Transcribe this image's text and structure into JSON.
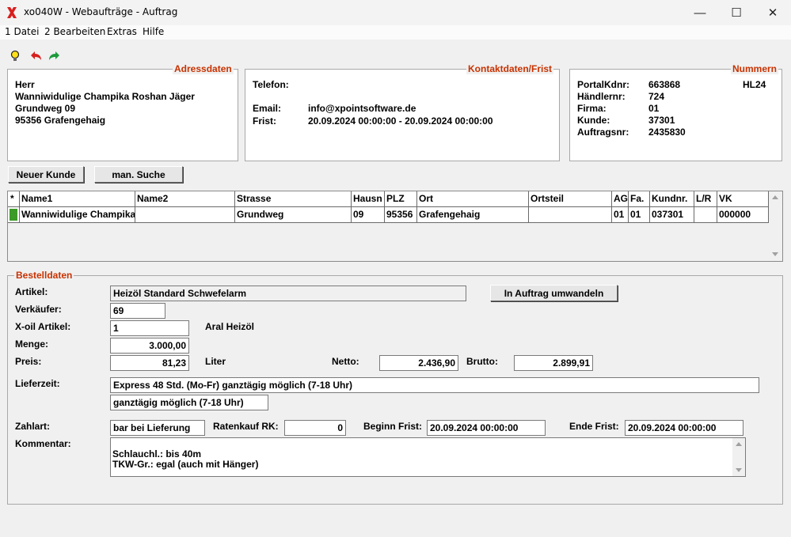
{
  "window": {
    "title": "xo040W - Webaufträge - Auftrag",
    "app_icon": "red-x-icon",
    "minimize": "—",
    "maximize": "☐",
    "close": "✕"
  },
  "menu": [
    "1 Datei",
    "2 Bearbeiten",
    "Extras",
    "Hilfe"
  ],
  "toolbar": {
    "icons": [
      "lightbulb-icon",
      "undo-icon",
      "redo-icon"
    ]
  },
  "adressdaten": {
    "title": "Adressdaten",
    "lines": [
      "Herr",
      "Wanniwidulige Champika Roshan  Jäger",
      "Grundweg 09",
      "95356 Grafengehaig"
    ]
  },
  "kontakt": {
    "title": "Kontaktdaten/Frist",
    "telefon_label": "Telefon:",
    "telefon_value": "",
    "email_label": "Email:",
    "email_value": "info@xpointsoftware.de",
    "frist_label": "Frist:",
    "frist_value": "20.09.2024 00:00:00  - 20.09.2024 00:00:00"
  },
  "nummern": {
    "title": "Nummern",
    "extra": "HL24",
    "rows": [
      {
        "label": "PortalKdnr:",
        "value": "663868"
      },
      {
        "label": "Händlernr:",
        "value": "724"
      },
      {
        "label": "Firma:",
        "value": "01"
      },
      {
        "label": "Kunde:",
        "value": "37301"
      },
      {
        "label": "Auftragsnr:",
        "value": "2435830"
      }
    ]
  },
  "buttons": {
    "neuer_kunde": "Neuer Kunde",
    "man_suche": "man. Suche",
    "umwandeln": "In Auftrag umwandeln"
  },
  "grid": {
    "columns": [
      "*",
      "Name1",
      "Name2",
      "Strasse",
      "Hausn",
      "PLZ",
      "Ort",
      "Ortsteil",
      "AG",
      "Fa.",
      "Kundnr.",
      "L/R",
      "VK"
    ],
    "rows": [
      [
        "",
        "Wanniwidulige Champika",
        "",
        "Grundweg",
        "09",
        "95356",
        "Grafengehaig",
        "",
        "01",
        "01",
        "037301",
        "",
        "000000"
      ]
    ],
    "selected_color": "#3c9a28"
  },
  "bestell": {
    "title": "Bestelldaten",
    "artikel_label": "Artikel:",
    "artikel_value": "Heizöl Standard Schwefelarm",
    "verkaeufer_label": "Verkäufer:",
    "verkaeufer_value": "69",
    "xoil_label": "X-oil Artikel:",
    "xoil_value": "1",
    "xoil_text": "Aral Heizöl",
    "menge_label": "Menge:",
    "menge_value": "3.000,00",
    "preis_label": "Preis:",
    "preis_value": "81,23",
    "liter_label": "Liter",
    "netto_label": "Netto:",
    "netto_value": "2.436,90",
    "brutto_label": "Brutto:",
    "brutto_value": "2.899,91",
    "lieferzeit_label": "Lieferzeit:",
    "lieferzeit_value1": "Express 48 Std. (Mo-Fr) ganztägig möglich (7-18 Uhr)",
    "lieferzeit_value2": "ganztägig möglich (7-18 Uhr)",
    "zahlart_label": "Zahlart:",
    "zahlart_value": "bar bei Lieferung",
    "ratenkauf_label": "Ratenkauf RK:",
    "ratenkauf_value": "0",
    "beginn_label": "Beginn Frist:",
    "beginn_value": "20.09.2024 00:00:00",
    "ende_label": "Ende Frist:",
    "ende_value": "20.09.2024 00:00:00",
    "kommentar_label": "Kommentar:",
    "kommentar_line1": "Schlauchl.: bis 40m",
    "kommentar_line2": "TKW-Gr.: egal (auch mit Hänger)"
  },
  "colors": {
    "accent": "#c83200",
    "group_border": "#a8a8a8"
  }
}
